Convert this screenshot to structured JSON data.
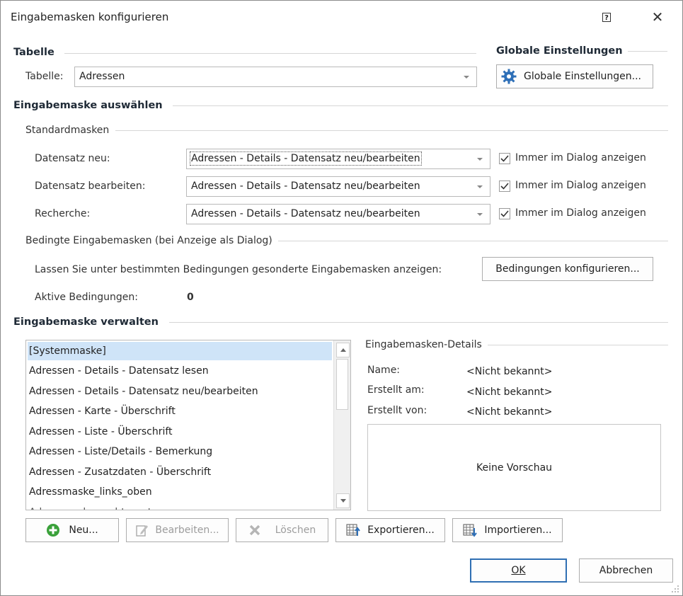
{
  "window": {
    "title": "Eingabemasken konfigurieren",
    "help_glyph": "?",
    "close_glyph": "✕"
  },
  "tabelle": {
    "section": "Tabelle",
    "label": "Tabelle:",
    "value": "Adressen"
  },
  "global": {
    "section": "Globale Einstellungen",
    "button": "Globale Einstellungen..."
  },
  "auswahl": {
    "section": "Eingabemaske auswählen",
    "standard": "Standardmasken",
    "rows": [
      {
        "label": "Datensatz neu:",
        "value": "Adressen - Details - Datensatz neu/bearbeiten",
        "check": "Immer im Dialog anzeigen",
        "checked": true
      },
      {
        "label": "Datensatz bearbeiten:",
        "value": "Adressen - Details - Datensatz neu/bearbeiten",
        "check": "Immer im Dialog anzeigen",
        "checked": true
      },
      {
        "label": "Recherche:",
        "value": "Adressen - Details - Datensatz neu/bearbeiten",
        "check": "Immer im Dialog anzeigen",
        "checked": true
      }
    ],
    "bedingt": "Bedingte Eingabemasken (bei Anzeige als Dialog)",
    "bedingt_text": "Lassen Sie unter bestimmten Bedingungen gesonderte Eingabemasken anzeigen:",
    "bedingt_button": "Bedingungen konfigurieren...",
    "aktive_label": "Aktive Bedingungen:",
    "aktive_value": "0"
  },
  "verwalten": {
    "section": "Eingabemaske verwalten",
    "list": [
      "[Systemmaske]",
      "Adressen - Details - Datensatz lesen",
      "Adressen - Details - Datensatz neu/bearbeiten",
      "Adressen - Karte - Überschrift",
      "Adressen - Liste - Überschrift",
      "Adressen - Liste/Details - Bemerkung",
      "Adressen - Zusatzdaten - Überschrift",
      "Adressmaske_links_oben"
    ],
    "selected_index": 0,
    "details_title": "Eingabemasken-Details",
    "details": [
      {
        "label": "Name:",
        "value": "<Nicht bekannt>"
      },
      {
        "label": "Erstellt am:",
        "value": "<Nicht bekannt>"
      },
      {
        "label": "Erstellt von:",
        "value": "<Nicht bekannt>"
      }
    ],
    "preview": "Keine Vorschau",
    "buttons": {
      "neu": "Neu...",
      "bearbeiten": "Bearbeiten...",
      "loeschen": "Löschen",
      "exportieren": "Exportieren...",
      "importieren": "Importieren..."
    }
  },
  "footer": {
    "ok": "OK",
    "abbrechen": "Abbrechen"
  },
  "colors": {
    "selection": "#cfe4f8",
    "ok_border": "#2f6fb3",
    "gear": "#2e6fb7",
    "add": "#3aa13a"
  }
}
